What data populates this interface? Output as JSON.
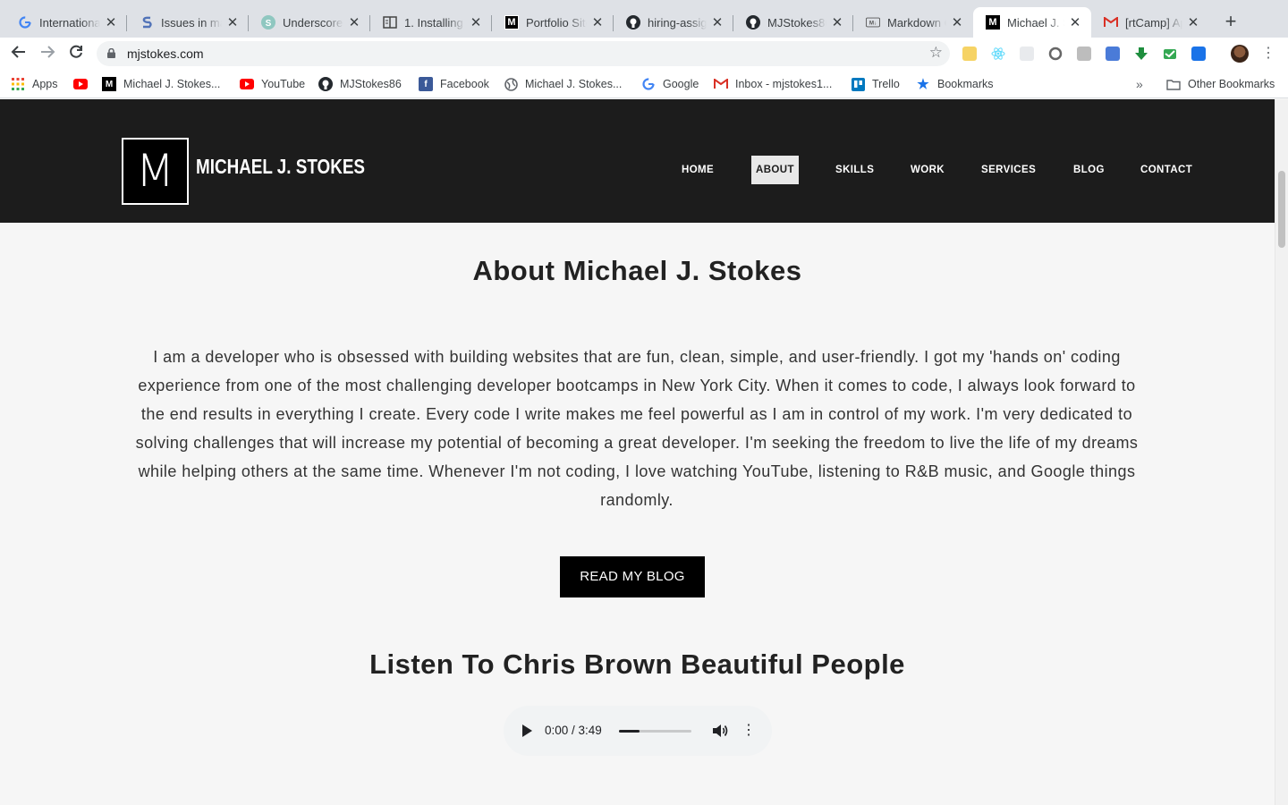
{
  "browser": {
    "tabs": [
      {
        "title": "International",
        "icon": "google-icon"
      },
      {
        "title": "Issues in ma",
        "icon": "stack-icon"
      },
      {
        "title": "Underscores",
        "icon": "underscores-icon"
      },
      {
        "title": "1. Installing",
        "icon": "book-icon"
      },
      {
        "title": "Portfolio Site",
        "icon": "m-logo-icon"
      },
      {
        "title": "hiring-assign",
        "icon": "github-icon"
      },
      {
        "title": "MJStokes86",
        "icon": "github-icon"
      },
      {
        "title": "Markdown C",
        "icon": "markdown-icon"
      },
      {
        "title": "Michael J. S",
        "icon": "m-logo-icon"
      },
      {
        "title": "[rtCamp] Ap",
        "icon": "gmail-icon"
      }
    ],
    "url": "mjstokes.com",
    "bookmarks": [
      {
        "label": "Apps",
        "icon": "apps-grid-icon"
      },
      {
        "label": "",
        "icon": "youtube-icon"
      },
      {
        "label": "Michael J. Stokes...",
        "icon": "m-logo-icon"
      },
      {
        "label": "YouTube",
        "icon": "youtube-icon"
      },
      {
        "label": "MJStokes86",
        "icon": "github-icon"
      },
      {
        "label": "Facebook",
        "icon": "facebook-icon"
      },
      {
        "label": "Michael J. Stokes...",
        "icon": "globe-icon"
      },
      {
        "label": "Google",
        "icon": "google-icon"
      },
      {
        "label": "Inbox - mjstokes1...",
        "icon": "gmail-icon"
      },
      {
        "label": "Trello",
        "icon": "trello-icon"
      },
      {
        "label": "Bookmarks",
        "icon": "star-icon"
      }
    ],
    "bookmarks_more": "»",
    "other_bookmarks": "Other Bookmarks"
  },
  "site": {
    "logo_letter": "M",
    "name": "MICHAEL J. STOKES",
    "nav": [
      "HOME",
      "ABOUT",
      "SKILLS",
      "WORK",
      "SERVICES",
      "BLOG",
      "CONTACT"
    ],
    "active_nav": "ABOUT"
  },
  "about": {
    "title": "About Michael J. Stokes",
    "text": "I am a developer who is obsessed with building websites that are fun, clean, simple, and user-friendly. I got my 'hands on' coding experience from one of the most challenging developer bootcamps in New York City. When it comes to code, I always look forward to the end results in everything I create. Every code I write makes me feel powerful as I am in control of my work. I'm very dedicated to solving challenges that will increase my potential of becoming a great developer. I'm seeking the freedom to live the life of my dreams while helping others at the same time. Whenever I'm not coding, I love watching YouTube, listening to R&B music, and Google things randomly.",
    "button": "READ MY BLOG"
  },
  "music": {
    "title": "Listen To Chris Brown Beautiful People",
    "time": "0:00 / 3:49",
    "progress_fraction": 0.28
  },
  "colors": {
    "header_bg": "#1c1c1c",
    "page_bg": "#f6f6f6",
    "button_bg": "#000000"
  }
}
